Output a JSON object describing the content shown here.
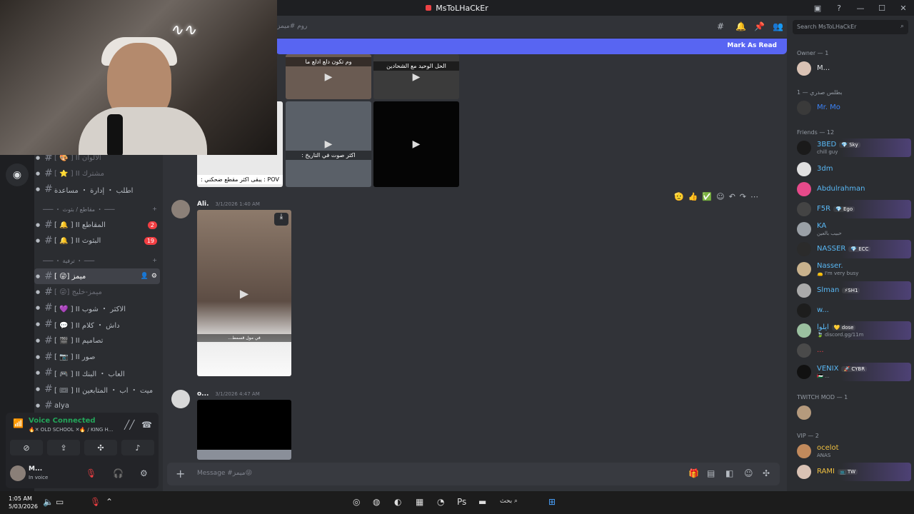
{
  "app": {
    "title": "MsToLHaCkEr"
  },
  "titlebar": {
    "min": "—",
    "max": "☐",
    "close": "✕"
  },
  "sidebar": {
    "channels": [
      {
        "name": "الألوان II [ 🎨 ]",
        "badge": "",
        "muted": true,
        "active": false
      },
      {
        "name": "مشترك II [ ⭐ ]",
        "badge": "",
        "muted": true,
        "active": false
      },
      {
        "name": "اطلب ・ إدارة ・ مساعدة",
        "badge": "",
        "muted": false,
        "active": false
      },
      {
        "name": "المقاطع II [ 🔔 ]",
        "badge": "2",
        "muted": false,
        "active": false
      },
      {
        "name": "البثوث II [ 🔔 ]",
        "badge": "19",
        "muted": false,
        "active": false
      },
      {
        "name": "ميمز [😜 ]",
        "badge": "",
        "muted": false,
        "active": true
      },
      {
        "name": "ميمز-خليج [😜 ]",
        "badge": "",
        "muted": true,
        "active": false
      },
      {
        "name": "الاكثر ・ شوب II [ 💜 ]",
        "badge": "",
        "muted": false,
        "active": false
      },
      {
        "name": "داش ・ كلام II [ 💬 ]",
        "badge": "",
        "muted": false,
        "active": false
      },
      {
        "name": "تصاميم II [ 🎬 ]",
        "badge": "",
        "muted": false,
        "active": false
      },
      {
        "name": "صور II [ 📷 ]",
        "badge": "",
        "muted": false,
        "active": false
      },
      {
        "name": "العاب ・ البنك II [ 🎮 ]",
        "badge": "",
        "muted": false,
        "active": false
      },
      {
        "name": "ميت ・ اب ・ المتابعين II [ 🎟 ]",
        "badge": "",
        "muted": false,
        "active": false
      },
      {
        "name": "alya",
        "badge": "",
        "muted": false,
        "active": false
      }
    ],
    "categories": [
      {
        "label": "─── ・ مقاطع / بثوث ・ ───",
        "plus": "+"
      },
      {
        "label": "─── ・ ترفية ・ ───",
        "plus": "+"
      }
    ]
  },
  "voice": {
    "status": "Voice Connected",
    "channel": "🔥✕ OLD SCHOOL ✕🔥 / KING H..."
  },
  "user": {
    "name": "M...",
    "status": "In voice"
  },
  "header": {
    "channel": "روم #ميمز"
  },
  "banner": {
    "label": "Mark As Read"
  },
  "thumbs_top": [
    {
      "caption": "وم تكون دلع ادلع ما"
    },
    {
      "caption": "الحل الوحيد مع الشحادين"
    },
    {
      "caption": "POV : يبقى اكثر مقطع ضحكني :"
    },
    {
      "caption": "اكثر صوت في التاريخ :"
    },
    {
      "caption": ""
    }
  ],
  "messages": [
    {
      "author": "Ali.",
      "time": "3/1/2026 1:40 AM"
    },
    {
      "author": "o...",
      "time": "3/1/2026 4:47 AM"
    }
  ],
  "video_caption": "في مول قسمط...",
  "composer": {
    "placeholder": "Message #ميمز😜"
  },
  "members": {
    "search": "Search MsToLHaCkEr",
    "groups": [
      {
        "label": "Owner — 1",
        "items": [
          {
            "name": "M...",
            "sub": "",
            "tag": "",
            "color": "#dbdee1"
          }
        ]
      },
      {
        "label": "بطلس صدري — 1",
        "items": [
          {
            "name": "Mr. Mo",
            "sub": "",
            "tag": "",
            "color": "#3b82f6"
          }
        ]
      },
      {
        "label": "Friends — 12",
        "items": [
          {
            "name": "3BED",
            "sub": "chill guy",
            "tag": "💎 Sky",
            "color": "#59b8f5"
          },
          {
            "name": "3dm",
            "sub": "",
            "tag": "",
            "color": "#59b8f5"
          },
          {
            "name": "Abdulrahman",
            "sub": "",
            "tag": "",
            "color": "#59b8f5"
          },
          {
            "name": "F5R",
            "sub": "",
            "tag": "💎 Ego",
            "color": "#59b8f5"
          },
          {
            "name": "KA",
            "sub": "حبيب بالعين",
            "tag": "",
            "color": "#59b8f5"
          },
          {
            "name": "NASSER",
            "sub": "",
            "tag": "💎 ECC",
            "color": "#59b8f5"
          },
          {
            "name": "Nasser.",
            "sub": "👝 I'm very busy",
            "tag": "",
            "color": "#59b8f5"
          },
          {
            "name": "Slman",
            "sub": "",
            "tag": "⚡SH1",
            "color": "#59b8f5"
          },
          {
            "name": "w...",
            "sub": "",
            "tag": "",
            "color": "#59b8f5"
          },
          {
            "name": "ايلوا",
            "sub": "🍃 discord.gg/11m",
            "tag": "💛 dose",
            "color": "#59b8f5"
          },
          {
            "name": "...",
            "sub": "",
            "tag": "",
            "color": "#ed4245"
          },
          {
            "name": "VENIX",
            "sub": "🇵🇸 ...",
            "tag": "🚀 CYBR",
            "color": "#59b8f5"
          }
        ]
      },
      {
        "label": "TWITCH MOD — 1",
        "items": [
          {
            "name": "",
            "sub": "",
            "tag": "",
            "color": "#dbdee1"
          }
        ]
      },
      {
        "label": "VIP — 2",
        "items": [
          {
            "name": "ocelot",
            "sub": "ANAS",
            "tag": "",
            "color": "#f0c040"
          },
          {
            "name": "RAMI",
            "sub": "",
            "tag": "📺 TW",
            "color": "#f0c040"
          }
        ]
      }
    ]
  },
  "taskbar": {
    "time": "1:05 AM",
    "date": "5/03/2026",
    "search": "بحث"
  }
}
